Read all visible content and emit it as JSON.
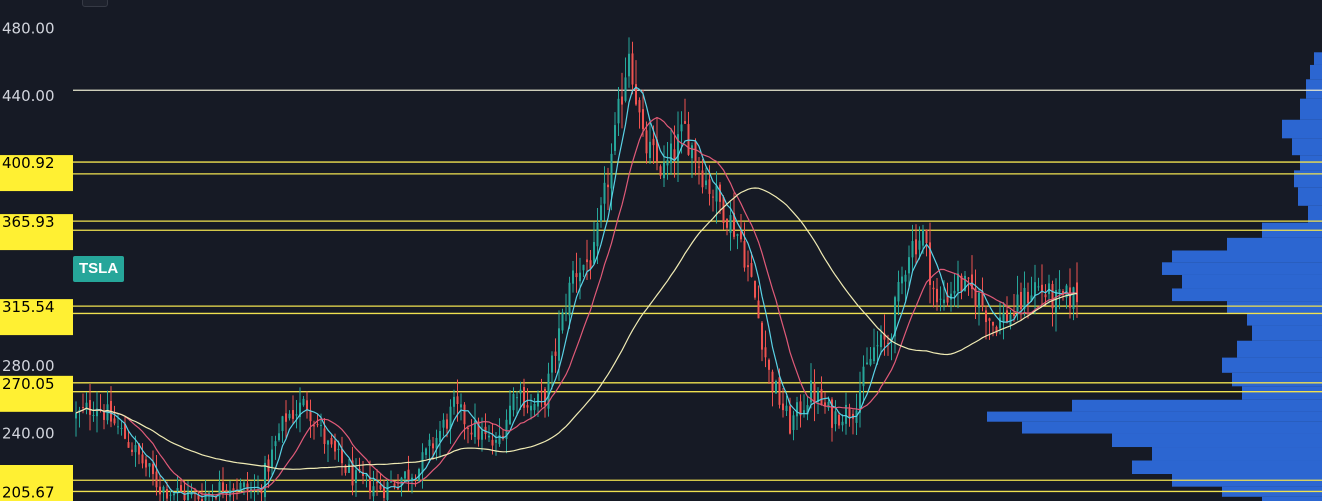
{
  "chart_data": {
    "type": "candlestick",
    "symbol": "TSLA",
    "ylim": [
      200,
      497
    ],
    "bar_count": 260,
    "y_axis_ticks": [
      {
        "value": 480,
        "label": "480.00"
      },
      {
        "value": 440,
        "label": "440.00"
      },
      {
        "value": 280,
        "label": "280.00"
      },
      {
        "value": 240,
        "label": "240.00"
      }
    ],
    "horizontal_levels": [
      {
        "value": 443.5,
        "color": "#e8e8d0",
        "tag": ""
      },
      {
        "value": 400.92,
        "color": "#f0e150",
        "tag": "400.92"
      },
      {
        "value": 393.92,
        "color": "#f0e150",
        "tag": ""
      },
      {
        "value": 365.93,
        "color": "#f0e150",
        "tag": "365.93"
      },
      {
        "value": 360.5,
        "color": "#f0e150",
        "tag": ""
      },
      {
        "value": 315.54,
        "color": "#f0e150",
        "tag": "315.54"
      },
      {
        "value": 311.2,
        "color": "#f0e150",
        "tag": ""
      },
      {
        "value": 270.05,
        "color": "#f0e150",
        "tag": "270.05"
      },
      {
        "value": 264.8,
        "color": "#f0e150",
        "tag": ""
      },
      {
        "value": 212.3,
        "color": "#f0e150",
        "tag": ""
      },
      {
        "value": 205.67,
        "color": "#f0e150",
        "tag": "205.67"
      }
    ],
    "close_path": [
      {
        "bar": 0,
        "price": 250
      },
      {
        "bar": 6,
        "price": 258
      },
      {
        "bar": 14,
        "price": 238
      },
      {
        "bar": 24,
        "price": 208
      },
      {
        "bar": 34,
        "price": 202
      },
      {
        "bar": 44,
        "price": 210
      },
      {
        "bar": 52,
        "price": 205
      },
      {
        "bar": 60,
        "price": 250
      },
      {
        "bar": 66,
        "price": 258
      },
      {
        "bar": 72,
        "price": 232
      },
      {
        "bar": 80,
        "price": 212
      },
      {
        "bar": 88,
        "price": 208
      },
      {
        "bar": 98,
        "price": 220
      },
      {
        "bar": 108,
        "price": 255
      },
      {
        "bar": 114,
        "price": 242
      },
      {
        "bar": 120,
        "price": 232
      },
      {
        "bar": 126,
        "price": 268
      },
      {
        "bar": 130,
        "price": 255
      },
      {
        "bar": 134,
        "price": 262
      },
      {
        "bar": 142,
        "price": 335
      },
      {
        "bar": 148,
        "price": 345
      },
      {
        "bar": 154,
        "price": 415
      },
      {
        "bar": 158,
        "price": 470
      },
      {
        "bar": 162,
        "price": 412
      },
      {
        "bar": 168,
        "price": 395
      },
      {
        "bar": 174,
        "price": 420
      },
      {
        "bar": 180,
        "price": 390
      },
      {
        "bar": 186,
        "price": 370
      },
      {
        "bar": 190,
        "price": 355
      },
      {
        "bar": 194,
        "price": 320
      },
      {
        "bar": 198,
        "price": 275
      },
      {
        "bar": 204,
        "price": 245
      },
      {
        "bar": 210,
        "price": 265
      },
      {
        "bar": 216,
        "price": 250
      },
      {
        "bar": 222,
        "price": 255
      },
      {
        "bar": 228,
        "price": 290
      },
      {
        "bar": 232,
        "price": 295
      },
      {
        "bar": 238,
        "price": 350
      },
      {
        "bar": 242,
        "price": 358
      },
      {
        "bar": 246,
        "price": 315
      },
      {
        "bar": 252,
        "price": 330
      },
      {
        "bar": 258,
        "price": 320
      },
      {
        "bar": 262,
        "price": 305
      },
      {
        "bar": 268,
        "price": 312
      },
      {
        "bar": 274,
        "price": 328
      },
      {
        "bar": 280,
        "price": 318
      },
      {
        "bar": 286,
        "price": 322
      }
    ],
    "ma_colors": {
      "fast": "#5ad2e6",
      "mid": "#e05a78",
      "slow": "#f0ebb4"
    },
    "candle_colors": {
      "up": "#26a69a",
      "down": "#ef5350"
    },
    "volume_profile_color": "#2f6fe4",
    "volume_profile": [
      {
        "price": 462,
        "width": 8
      },
      {
        "price": 455,
        "width": 12
      },
      {
        "price": 445,
        "width": 16
      },
      {
        "price": 432,
        "width": 22
      },
      {
        "price": 420,
        "width": 40
      },
      {
        "price": 410,
        "width": 30
      },
      {
        "price": 400,
        "width": 22
      },
      {
        "price": 392,
        "width": 28
      },
      {
        "price": 380,
        "width": 24
      },
      {
        "price": 370,
        "width": 14
      },
      {
        "price": 360,
        "width": 60
      },
      {
        "price": 352,
        "width": 95
      },
      {
        "price": 345,
        "width": 150
      },
      {
        "price": 338,
        "width": 160
      },
      {
        "price": 330,
        "width": 140
      },
      {
        "price": 322,
        "width": 150
      },
      {
        "price": 315,
        "width": 95
      },
      {
        "price": 308,
        "width": 75
      },
      {
        "price": 300,
        "width": 70
      },
      {
        "price": 290,
        "width": 85
      },
      {
        "price": 280,
        "width": 100
      },
      {
        "price": 272,
        "width": 90
      },
      {
        "price": 264,
        "width": 80
      },
      {
        "price": 256,
        "width": 250
      },
      {
        "price": 250,
        "width": 335
      },
      {
        "price": 244,
        "width": 300
      },
      {
        "price": 236,
        "width": 210
      },
      {
        "price": 228,
        "width": 170
      },
      {
        "price": 220,
        "width": 190
      },
      {
        "price": 212,
        "width": 150
      },
      {
        "price": 205,
        "width": 100
      },
      {
        "price": 200,
        "width": 60
      }
    ]
  }
}
